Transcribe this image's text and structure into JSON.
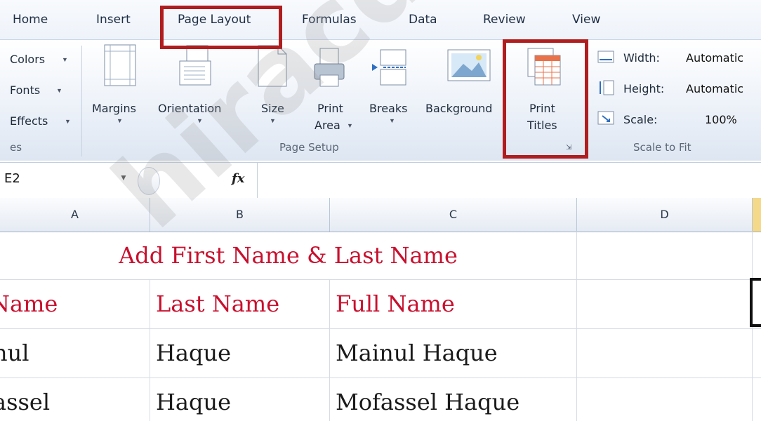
{
  "tabs": [
    "Home",
    "Insert",
    "Page Layout",
    "Formulas",
    "Data",
    "Review",
    "View"
  ],
  "active_tab": "Page Layout",
  "themes": {
    "colors": "Colors",
    "fonts": "Fonts",
    "effects": "Effects",
    "group_label": "es"
  },
  "page_setup": {
    "margins": "Margins",
    "orientation": "Orientation",
    "size": "Size",
    "print_area_1": "Print",
    "print_area_2": "Area",
    "breaks": "Breaks",
    "background": "Background",
    "print_titles_1": "Print",
    "print_titles_2": "Titles",
    "group_label": "Page Setup"
  },
  "scale_to_fit": {
    "width_label": "Width:",
    "width_value": "Automatic",
    "height_label": "Height:",
    "height_value": "Automatic",
    "scale_label": "Scale:",
    "scale_value": "100%",
    "group_label": "Scale to Fit"
  },
  "formula_bar": {
    "name_box": "E2",
    "fx": "fx",
    "formula": ""
  },
  "columns": [
    "A",
    "B",
    "C",
    "D"
  ],
  "sheet": {
    "title": "Add First Name & Last Name",
    "headers": [
      "Name",
      "Last Name",
      "Full Name"
    ],
    "rows": [
      [
        "nul",
        "Haque",
        "Mainul Haque"
      ],
      [
        "assel",
        "Haque",
        "Mofassel Haque"
      ]
    ]
  },
  "watermark": "hiracdy",
  "colors": {
    "accent_red": "#c8102e",
    "highlight_box": "#b01d1f"
  }
}
